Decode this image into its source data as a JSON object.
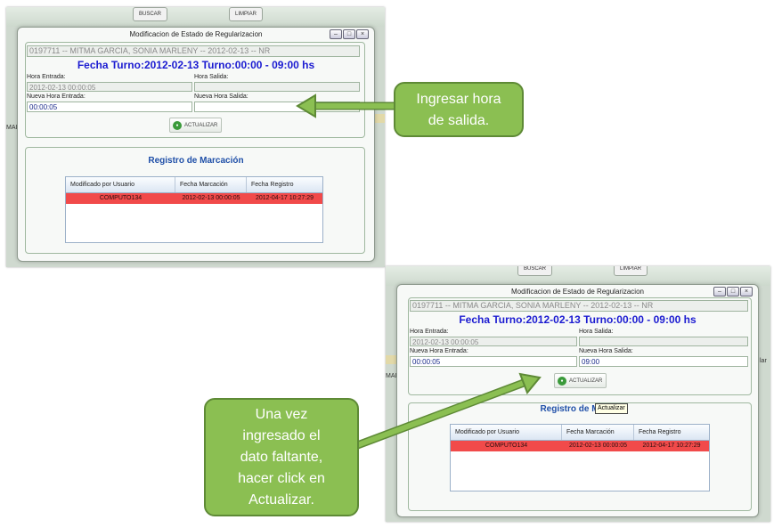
{
  "screenshot1": {
    "background": {
      "buscar_label": "BUSCAR",
      "limpiar_label": "LIMPIAR",
      "side_tag": "MAI"
    },
    "window": {
      "title": "Modificacion de Estado de Regularizacion",
      "record": "0197711 -- MITMA GARCIA, SONIA MARLENY -- 2012-02-13 -- NR",
      "shift": "Fecha Turno:2012-02-13 Turno:00:00 - 09:00 hs",
      "hora_entrada_label": "Hora Entrada:",
      "hora_entrada_value": "2012-02-13 00:00:05",
      "hora_salida_label": "Hora Salida:",
      "hora_salida_value": "",
      "nueva_entrada_label": "Nueva Hora Entrada:",
      "nueva_entrada_value": "00:00:05",
      "nueva_salida_label": "Nueva Hora Salida:",
      "nueva_salida_value": "",
      "actualizar_label": "ACTUALIZAR",
      "registro_title": "Registro de Marcación",
      "table_headers": [
        "Modificado por Usuario",
        "Fecha Marcación",
        "Fecha Registro"
      ],
      "table_row": [
        "COMPUTO134",
        "2012-02-13 00:00:05",
        "2012-04-17 10:27:29"
      ]
    }
  },
  "screenshot2": {
    "background": {
      "buscar_label": "BUSCAR",
      "limpiar_label": "LIMPIAR",
      "side_tag_left": "MAI",
      "side_tag_right": "lar"
    },
    "window": {
      "title": "Modificacion de Estado de Regularizacion",
      "record": "0197711 -- MITMA GARCIA, SONIA MARLENY -- 2012-02-13 -- NR",
      "shift": "Fecha Turno:2012-02-13 Turno:00:00 - 09:00 hs",
      "hora_entrada_label": "Hora Entrada:",
      "hora_entrada_value": "2012-02-13 00:00:05",
      "hora_salida_label": "Hora Salida:",
      "hora_salida_value": "",
      "nueva_entrada_label": "Nueva Hora Entrada:",
      "nueva_entrada_value": "00:00:05",
      "nueva_salida_label": "Nueva Hora Salida:",
      "nueva_salida_value": "09:00",
      "actualizar_label": "ACTUALIZAR",
      "registro_title": "Registro de M",
      "tooltip": "Actualizar",
      "table_headers": [
        "Modificado por Usuario",
        "Fecha Marcación",
        "Fecha Registro"
      ],
      "table_row": [
        "COMPUTO134",
        "2012-02-13 00:00:05",
        "2012-04-17 10:27:29"
      ]
    }
  },
  "callouts": {
    "ingresar": "Ingresar hora\nde salida.",
    "una_vez": "Una vez\ningresado el\ndato faltante,\nhacer click en\nActualizar."
  },
  "colors": {
    "callout_fill": "#8bbf52",
    "callout_border": "#5e8a36",
    "row_highlight": "#f14a4a",
    "shift_text": "#1b1bd1"
  },
  "icons": [
    "window-minimize-icon",
    "window-maximize-icon",
    "window-close-icon",
    "actualizar-icon"
  ]
}
